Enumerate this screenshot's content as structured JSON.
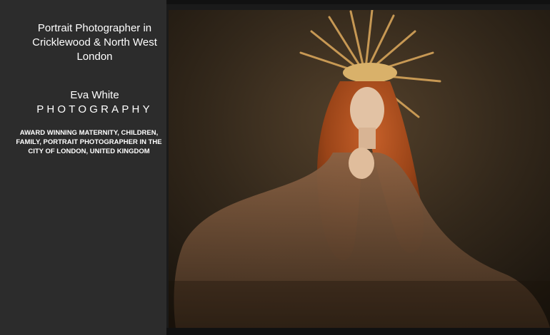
{
  "sidebar": {
    "tagline_line1": "Portrait Photographer in",
    "tagline_line2": "Cricklewood & North West",
    "tagline_line3": "London",
    "brand_name": "Eva White",
    "brand_sub": "PHOTOGRAPHY",
    "desc_line1": "AWARD WINNING MATERNITY,  CHILDREN,",
    "desc_line2": "FAMILY, PORTRAIT PHOTOGRAPHER IN THE",
    "desc_line3": "CITY OF LONDON, UNITED KINGDOM"
  },
  "colors": {
    "sidebar_bg": "#2c2c2c",
    "text": "#ffffff",
    "hair": "#b5501e"
  }
}
